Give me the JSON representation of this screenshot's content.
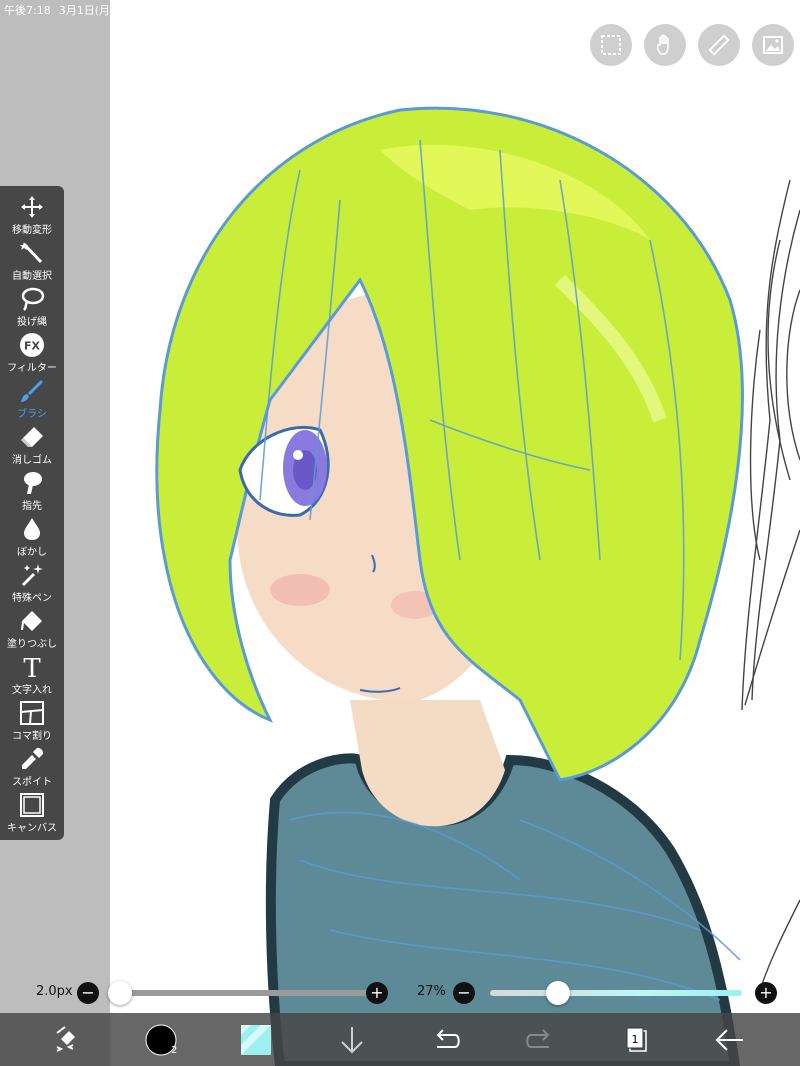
{
  "status": {
    "time": "午後7:18",
    "date": "3月1日(月"
  },
  "tools": [
    {
      "name": "move-transform",
      "label": "移動変形",
      "icon": "move-icon"
    },
    {
      "name": "auto-select",
      "label": "自動選択",
      "icon": "magic-wand-icon"
    },
    {
      "name": "lasso",
      "label": "投げ縄",
      "icon": "lasso-icon"
    },
    {
      "name": "filter",
      "label": "フィルター",
      "icon": "fx-icon"
    },
    {
      "name": "brush",
      "label": "ブラシ",
      "icon": "brush-icon",
      "active": true
    },
    {
      "name": "eraser",
      "label": "消しゴム",
      "icon": "eraser-icon"
    },
    {
      "name": "finger",
      "label": "指先",
      "icon": "finger-smudge-icon"
    },
    {
      "name": "blur",
      "label": "ぼかし",
      "icon": "drop-icon"
    },
    {
      "name": "special-pen",
      "label": "特殊ペン",
      "icon": "sparkle-pen-icon"
    },
    {
      "name": "fill",
      "label": "塗りつぶし",
      "icon": "bucket-icon"
    },
    {
      "name": "text",
      "label": "文字入れ",
      "icon": "text-icon"
    },
    {
      "name": "frame-divider",
      "label": "コマ割り",
      "icon": "panel-divider-icon"
    },
    {
      "name": "eyedropper",
      "label": "スポイト",
      "icon": "eyedropper-icon"
    },
    {
      "name": "canvas",
      "label": "キャンバス",
      "icon": "canvas-icon"
    }
  ],
  "top_buttons": [
    "selection-icon",
    "hand-icon",
    "ruler-icon",
    "image-icon"
  ],
  "sliders": {
    "size": {
      "label": "2.0px",
      "value_fraction": 0.0
    },
    "opacity": {
      "label": "27%",
      "value_fraction": 0.27
    }
  },
  "bottom_bar": {
    "layer_count": "1",
    "brush_badge": "2"
  },
  "colors": {
    "accent": "#46a3f5",
    "primary_color": "#000000",
    "secondary_color": "#9ef0f0",
    "toolbar_bg": "#474747",
    "bottom_bg": "#464646"
  }
}
